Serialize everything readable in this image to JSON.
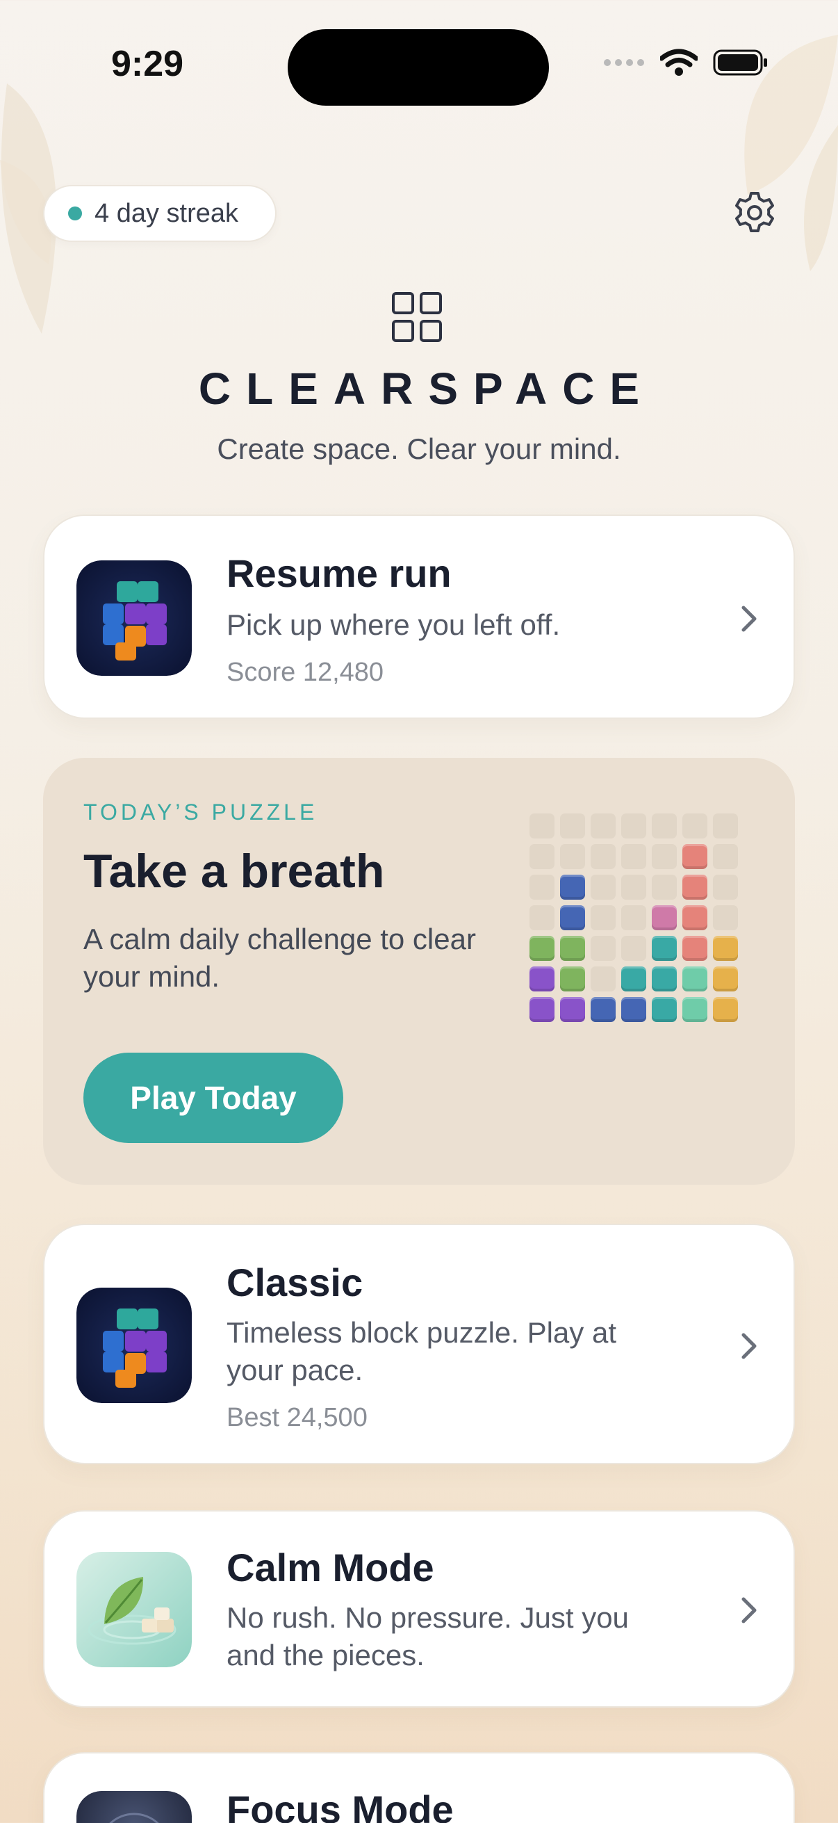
{
  "status_bar": {
    "time": "9:29"
  },
  "header": {
    "streak_label": "4 day streak",
    "app_title": "CLEARSPACE",
    "tagline": "Create space. Clear your mind."
  },
  "resume": {
    "title": "Resume run",
    "description": "Pick up where you left off.",
    "score": "Score 12,480"
  },
  "daily": {
    "label": "TODAY’S PUZZLE",
    "title": "Take a breath",
    "description": "A calm daily challenge to clear your mind.",
    "button": "Play Today",
    "grid_rows": [
      "EEEEEEE",
      "EEEEECE",
      "EBEEECE",
      "EBEEPCE",
      "GGEETCY",
      "VGETTMY",
      "VVBBTMY"
    ],
    "colors": {
      "E": "#e1d6c7",
      "C": "#e5837a",
      "B": "#4566b4",
      "P": "#cf7aa8",
      "G": "#7fb45e",
      "T": "#39a9a5",
      "Y": "#e6b14b",
      "V": "#8953c9",
      "M": "#6fcca9"
    }
  },
  "modes": [
    {
      "title": "Classic",
      "description": "Timeless block puzzle. Play at your pace.",
      "meta": "Best 24,500"
    },
    {
      "title": "Calm Mode",
      "description": "No rush. No pressure. Just you and the pieces."
    },
    {
      "title": "Focus Mode"
    }
  ],
  "accent_color": "#3aa9a2"
}
